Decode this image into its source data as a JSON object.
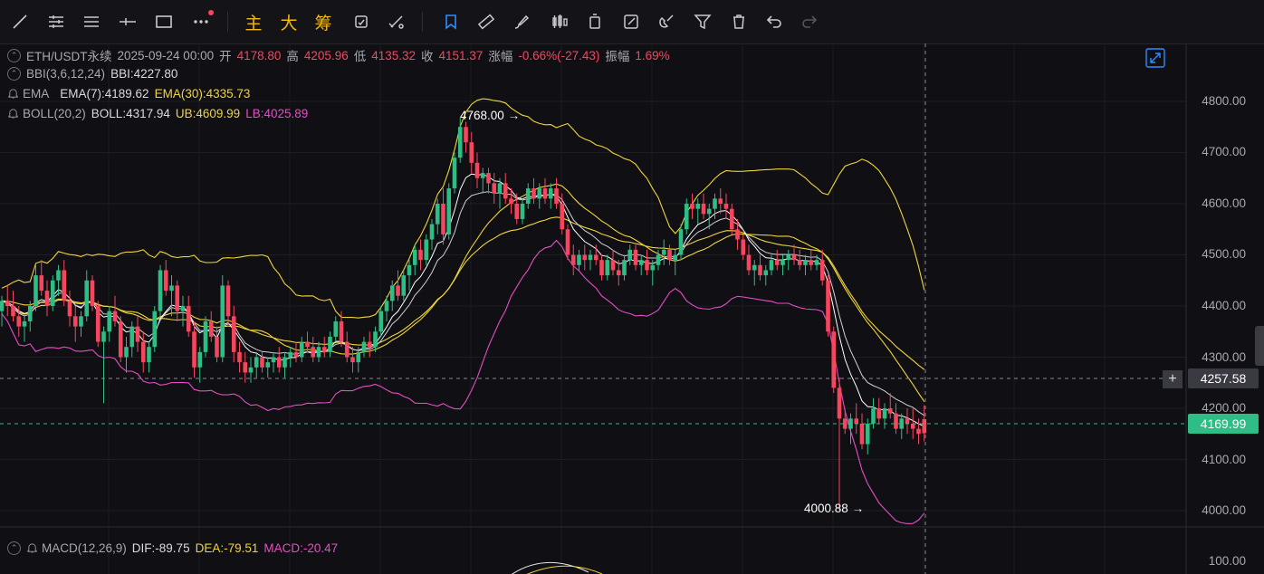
{
  "toolbar": {
    "tools": [
      "line-tool",
      "horizontal-lines-tool",
      "parallel-lines-tool",
      "horizontal-ray-tool",
      "rectangle-tool",
      "more-tools"
    ],
    "indicator_buttons": [
      "主",
      "大",
      "筹"
    ],
    "actions": [
      "bookmark-tool",
      "ruler-tool",
      "brush-tool",
      "candle-style-tool",
      "delete-panel-tool",
      "edit-note-tool",
      "magnet-tool",
      "filter-tool",
      "trash-tool",
      "undo",
      "redo"
    ]
  },
  "header": {
    "symbol": "ETH/USDT永续",
    "datetime": "2025-09-24 00:00",
    "open_label": "开",
    "open": "4178.80",
    "high_label": "高",
    "high": "4205.96",
    "low_label": "低",
    "low": "4135.32",
    "close_label": "收",
    "close": "4151.37",
    "change_label": "涨幅",
    "change": "-0.66%(-27.43)",
    "amplitude_label": "振幅",
    "amplitude": "1.69%"
  },
  "indicators": {
    "bbi_name": "BBI(3,6,12,24)",
    "bbi_value": "BBI:4227.80",
    "ema_name": "EMA",
    "ema7": "EMA(7):4189.62",
    "ema30": "EMA(30):4335.73",
    "boll_name": "BOLL(20,2)",
    "boll_mid": "BOLL:4317.94",
    "boll_ub": "UB:4609.99",
    "boll_lb": "LB:4025.89",
    "macd_name": "MACD(12,26,9)",
    "dif": "DIF:-89.75",
    "dea": "DEA:-79.51",
    "macd": "MACD:-20.47"
  },
  "annotations": {
    "high_marker": "4768.00",
    "low_marker": "4000.88"
  },
  "price_axis": {
    "ticks": [
      "4800.00",
      "4700.00",
      "4600.00",
      "4500.00",
      "4400.00",
      "4300.00",
      "4200.00",
      "4100.00",
      "4000.00"
    ],
    "cursor_price": "4257.58",
    "last_price": "4169.99",
    "macd_tick": "100.00"
  },
  "colors": {
    "up": "#2ebd85",
    "down": "#f6465d",
    "ema7": "#ffffff",
    "ema30": "#f0d33c",
    "boll_lb": "#e64cc4",
    "accent": "#2f8cff"
  },
  "chart_data": {
    "type": "candlestick",
    "ylim": [
      3970,
      4870
    ],
    "overlays": [
      "BBI",
      "EMA(7)",
      "EMA(30)",
      "BOLL(20,2)"
    ],
    "candles": [
      [
        4390,
        4420,
        4360,
        4410
      ],
      [
        4410,
        4440,
        4380,
        4400
      ],
      [
        4400,
        4430,
        4370,
        4380
      ],
      [
        4380,
        4400,
        4340,
        4360
      ],
      [
        4360,
        4380,
        4330,
        4370
      ],
      [
        4370,
        4410,
        4350,
        4400
      ],
      [
        4400,
        4480,
        4390,
        4460
      ],
      [
        4460,
        4490,
        4420,
        4430
      ],
      [
        4430,
        4450,
        4380,
        4400
      ],
      [
        4400,
        4460,
        4390,
        4450
      ],
      [
        4450,
        4480,
        4420,
        4470
      ],
      [
        4470,
        4490,
        4400,
        4410
      ],
      [
        4410,
        4430,
        4360,
        4380
      ],
      [
        4380,
        4400,
        4330,
        4360
      ],
      [
        4360,
        4390,
        4340,
        4380
      ],
      [
        4380,
        4470,
        4370,
        4450
      ],
      [
        4450,
        4460,
        4390,
        4400
      ],
      [
        4400,
        4410,
        4320,
        4330
      ],
      [
        4330,
        4360,
        4210,
        4350
      ],
      [
        4350,
        4400,
        4330,
        4390
      ],
      [
        4390,
        4420,
        4360,
        4370
      ],
      [
        4370,
        4380,
        4290,
        4300
      ],
      [
        4300,
        4340,
        4270,
        4320
      ],
      [
        4320,
        4370,
        4300,
        4360
      ],
      [
        4360,
        4380,
        4310,
        4330
      ],
      [
        4330,
        4350,
        4270,
        4290
      ],
      [
        4290,
        4330,
        4270,
        4320
      ],
      [
        4320,
        4400,
        4310,
        4390
      ],
      [
        4390,
        4480,
        4380,
        4470
      ],
      [
        4470,
        4490,
        4420,
        4430
      ],
      [
        4430,
        4460,
        4380,
        4440
      ],
      [
        4440,
        4450,
        4370,
        4390
      ],
      [
        4390,
        4420,
        4360,
        4400
      ],
      [
        4400,
        4420,
        4340,
        4350
      ],
      [
        4350,
        4370,
        4260,
        4280
      ],
      [
        4280,
        4320,
        4250,
        4310
      ],
      [
        4310,
        4380,
        4300,
        4370
      ],
      [
        4370,
        4390,
        4330,
        4340
      ],
      [
        4340,
        4360,
        4290,
        4300
      ],
      [
        4300,
        4460,
        4290,
        4440
      ],
      [
        4440,
        4450,
        4360,
        4380
      ],
      [
        4380,
        4400,
        4290,
        4310
      ],
      [
        4310,
        4330,
        4270,
        4290
      ],
      [
        4290,
        4310,
        4250,
        4270
      ],
      [
        4270,
        4300,
        4250,
        4280
      ],
      [
        4280,
        4310,
        4260,
        4300
      ],
      [
        4300,
        4310,
        4270,
        4280
      ],
      [
        4280,
        4300,
        4260,
        4290
      ],
      [
        4290,
        4310,
        4270,
        4300
      ],
      [
        4300,
        4320,
        4270,
        4280
      ],
      [
        4280,
        4310,
        4260,
        4300
      ],
      [
        4300,
        4320,
        4280,
        4310
      ],
      [
        4310,
        4330,
        4290,
        4300
      ],
      [
        4300,
        4340,
        4290,
        4330
      ],
      [
        4330,
        4350,
        4310,
        4320
      ],
      [
        4320,
        4340,
        4290,
        4300
      ],
      [
        4300,
        4330,
        4290,
        4320
      ],
      [
        4320,
        4340,
        4300,
        4310
      ],
      [
        4310,
        4350,
        4300,
        4340
      ],
      [
        4340,
        4380,
        4330,
        4370
      ],
      [
        4370,
        4390,
        4320,
        4330
      ],
      [
        4330,
        4350,
        4290,
        4300
      ],
      [
        4300,
        4320,
        4270,
        4290
      ],
      [
        4290,
        4320,
        4270,
        4310
      ],
      [
        4310,
        4340,
        4300,
        4330
      ],
      [
        4330,
        4350,
        4300,
        4320
      ],
      [
        4320,
        4360,
        4310,
        4350
      ],
      [
        4350,
        4400,
        4340,
        4390
      ],
      [
        4390,
        4420,
        4370,
        4410
      ],
      [
        4410,
        4450,
        4390,
        4440
      ],
      [
        4440,
        4470,
        4410,
        4420
      ],
      [
        4420,
        4470,
        4410,
        4460
      ],
      [
        4460,
        4490,
        4430,
        4480
      ],
      [
        4480,
        4520,
        4460,
        4510
      ],
      [
        4510,
        4530,
        4470,
        4490
      ],
      [
        4490,
        4540,
        4480,
        4530
      ],
      [
        4530,
        4570,
        4510,
        4560
      ],
      [
        4560,
        4610,
        4540,
        4600
      ],
      [
        4600,
        4630,
        4520,
        4540
      ],
      [
        4540,
        4640,
        4530,
        4630
      ],
      [
        4630,
        4700,
        4620,
        4690
      ],
      [
        4690,
        4768,
        4680,
        4750
      ],
      [
        4750,
        4760,
        4700,
        4720
      ],
      [
        4720,
        4740,
        4660,
        4680
      ],
      [
        4680,
        4700,
        4630,
        4650
      ],
      [
        4650,
        4670,
        4620,
        4660
      ],
      [
        4660,
        4670,
        4620,
        4640
      ],
      [
        4640,
        4660,
        4600,
        4620
      ],
      [
        4620,
        4650,
        4590,
        4640
      ],
      [
        4640,
        4660,
        4600,
        4610
      ],
      [
        4610,
        4630,
        4580,
        4600
      ],
      [
        4600,
        4620,
        4560,
        4570
      ],
      [
        4570,
        4610,
        4560,
        4600
      ],
      [
        4600,
        4640,
        4590,
        4630
      ],
      [
        4630,
        4650,
        4600,
        4610
      ],
      [
        4610,
        4640,
        4590,
        4630
      ],
      [
        4630,
        4650,
        4600,
        4610
      ],
      [
        4610,
        4640,
        4590,
        4630
      ],
      [
        4630,
        4650,
        4590,
        4600
      ],
      [
        4600,
        4620,
        4540,
        4550
      ],
      [
        4550,
        4560,
        4490,
        4500
      ],
      [
        4500,
        4520,
        4460,
        4480
      ],
      [
        4480,
        4510,
        4470,
        4500
      ],
      [
        4500,
        4520,
        4470,
        4490
      ],
      [
        4490,
        4510,
        4470,
        4500
      ],
      [
        4500,
        4520,
        4480,
        4490
      ],
      [
        4490,
        4500,
        4450,
        4460
      ],
      [
        4460,
        4500,
        4450,
        4490
      ],
      [
        4490,
        4510,
        4460,
        4470
      ],
      [
        4470,
        4490,
        4440,
        4460
      ],
      [
        4460,
        4500,
        4450,
        4490
      ],
      [
        4490,
        4520,
        4480,
        4510
      ],
      [
        4510,
        4520,
        4470,
        4480
      ],
      [
        4480,
        4500,
        4460,
        4490
      ],
      [
        4490,
        4510,
        4460,
        4470
      ],
      [
        4470,
        4490,
        4440,
        4480
      ],
      [
        4480,
        4510,
        4470,
        4500
      ],
      [
        4500,
        4530,
        4480,
        4510
      ],
      [
        4510,
        4520,
        4480,
        4490
      ],
      [
        4490,
        4510,
        4460,
        4500
      ],
      [
        4500,
        4560,
        4490,
        4550
      ],
      [
        4550,
        4610,
        4540,
        4600
      ],
      [
        4600,
        4620,
        4570,
        4590
      ],
      [
        4590,
        4610,
        4560,
        4600
      ],
      [
        4600,
        4620,
        4570,
        4580
      ],
      [
        4580,
        4600,
        4550,
        4590
      ],
      [
        4590,
        4620,
        4570,
        4610
      ],
      [
        4610,
        4630,
        4580,
        4600
      ],
      [
        4600,
        4620,
        4570,
        4590
      ],
      [
        4590,
        4600,
        4540,
        4550
      ],
      [
        4550,
        4570,
        4510,
        4530
      ],
      [
        4530,
        4540,
        4490,
        4500
      ],
      [
        4500,
        4520,
        4460,
        4470
      ],
      [
        4470,
        4490,
        4440,
        4480
      ],
      [
        4480,
        4500,
        4450,
        4460
      ],
      [
        4460,
        4480,
        4440,
        4470
      ],
      [
        4470,
        4500,
        4460,
        4490
      ],
      [
        4490,
        4510,
        4470,
        4480
      ],
      [
        4480,
        4500,
        4460,
        4490
      ],
      [
        4490,
        4510,
        4470,
        4500
      ],
      [
        4500,
        4520,
        4480,
        4490
      ],
      [
        4490,
        4510,
        4470,
        4480
      ],
      [
        4480,
        4500,
        4460,
        4490
      ],
      [
        4490,
        4510,
        4470,
        4480
      ],
      [
        4480,
        4500,
        4470,
        4490
      ],
      [
        4490,
        4510,
        4440,
        4450
      ],
      [
        4450,
        4460,
        4340,
        4350
      ],
      [
        4350,
        4360,
        4230,
        4240
      ],
      [
        4240,
        4260,
        4000.88,
        4180
      ],
      [
        4180,
        4200,
        4150,
        4160
      ],
      [
        4160,
        4190,
        4130,
        4180
      ],
      [
        4180,
        4210,
        4150,
        4170
      ],
      [
        4170,
        4190,
        4120,
        4130
      ],
      [
        4130,
        4180,
        4110,
        4170
      ],
      [
        4170,
        4220,
        4160,
        4200
      ],
      [
        4200,
        4220,
        4170,
        4180
      ],
      [
        4180,
        4210,
        4160,
        4200
      ],
      [
        4200,
        4230,
        4180,
        4190
      ],
      [
        4190,
        4210,
        4150,
        4160
      ],
      [
        4160,
        4190,
        4140,
        4180
      ],
      [
        4180,
        4200,
        4150,
        4170
      ],
      [
        4170,
        4200,
        4140,
        4160
      ],
      [
        4160,
        4180,
        4130,
        4150
      ],
      [
        4178.8,
        4205.96,
        4135.32,
        4151.37
      ]
    ]
  }
}
